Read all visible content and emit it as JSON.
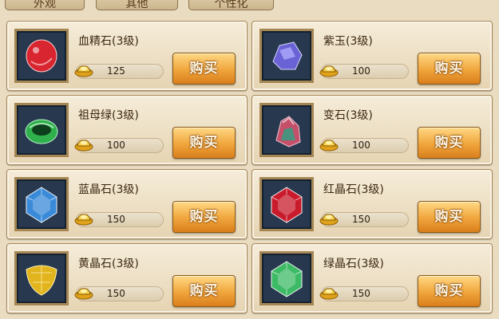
{
  "tabs": [
    "外观",
    "其他",
    "个性化"
  ],
  "currency_icon": "gold-ingot-icon",
  "items": [
    {
      "name": "血精石(3级)",
      "price": "125",
      "button": "购买",
      "gem_color": "#d8252f",
      "icon": "blood-essence-stone-icon"
    },
    {
      "name": "紫玉(3级)",
      "price": "100",
      "button": "购买",
      "gem_color": "#6a63d6",
      "icon": "purple-jade-icon"
    },
    {
      "name": "祖母绿(3级)",
      "price": "100",
      "button": "购买",
      "gem_color": "#2fb04c",
      "icon": "emerald-ring-icon"
    },
    {
      "name": "变石(3级)",
      "price": "100",
      "button": "购买",
      "gem_color": "#c4506a",
      "icon": "alexandrite-icon"
    },
    {
      "name": "蓝晶石(3级)",
      "price": "150",
      "button": "购买",
      "gem_color": "#3a8fe0",
      "icon": "blue-crystal-icon"
    },
    {
      "name": "红晶石(3级)",
      "price": "150",
      "button": "购买",
      "gem_color": "#d21a2a",
      "icon": "red-crystal-icon"
    },
    {
      "name": "黄晶石(3级)",
      "price": "150",
      "button": "购买",
      "gem_color": "#e2b41e",
      "icon": "yellow-crystal-icon"
    },
    {
      "name": "绿晶石(3级)",
      "price": "150",
      "button": "购买",
      "gem_color": "#3fc267",
      "icon": "green-crystal-icon"
    }
  ]
}
